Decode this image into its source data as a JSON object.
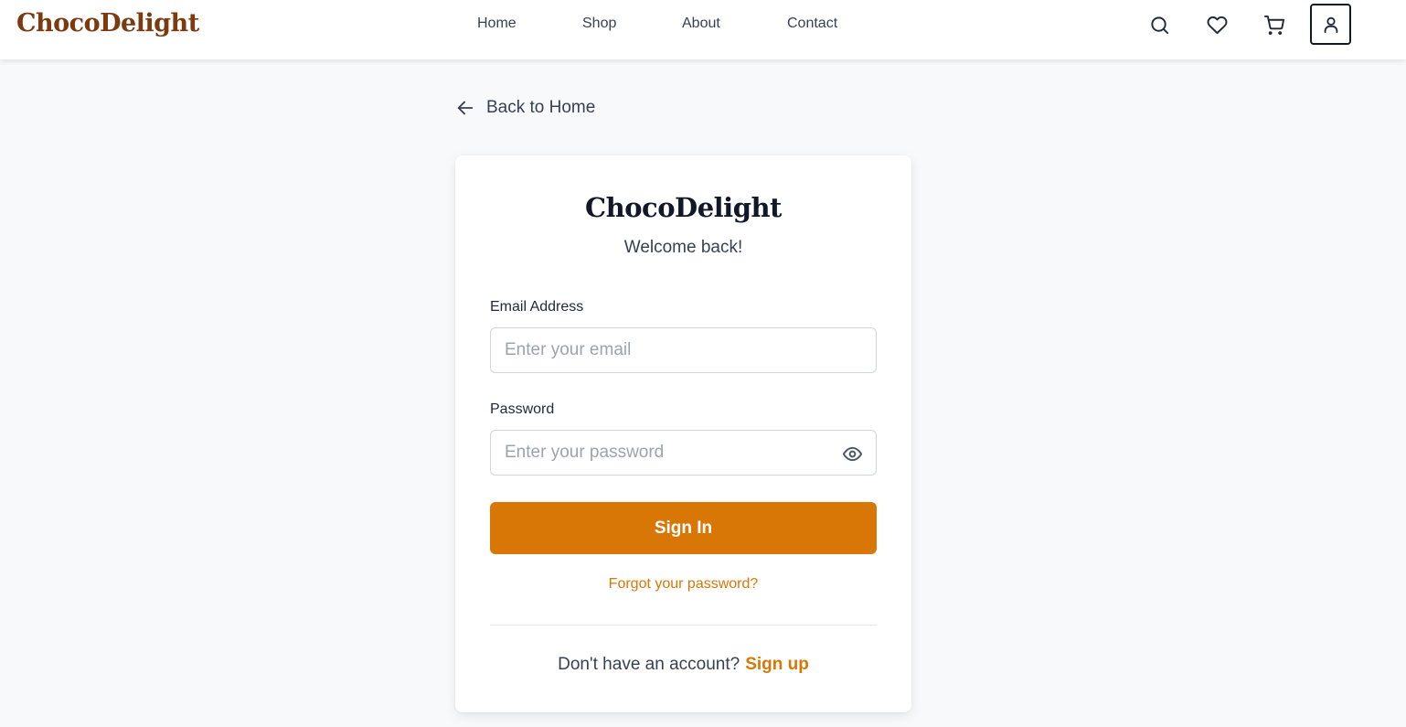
{
  "header": {
    "brand": "ChocoDelight",
    "nav": [
      "Home",
      "Shop",
      "About",
      "Contact"
    ],
    "icons": [
      "search-icon",
      "heart-icon",
      "cart-icon",
      "user-icon"
    ]
  },
  "back_link": {
    "label": "Back to Home",
    "icon": "arrow-left-icon"
  },
  "login_card": {
    "title": "ChocoDelight",
    "subtitle": "Welcome back!",
    "email": {
      "label": "Email Address",
      "placeholder": "Enter your email",
      "value": ""
    },
    "password": {
      "label": "Password",
      "placeholder": "Enter your password",
      "value": "",
      "toggle_icon": "eye-icon"
    },
    "submit_label": "Sign In",
    "forgot_label": "Forgot your password?",
    "signup_prompt": "Don't have an account?",
    "signup_label": "Sign up"
  },
  "colors": {
    "brand": "#7c3a10",
    "accent": "#d97706",
    "background": "#f8f9fb"
  }
}
